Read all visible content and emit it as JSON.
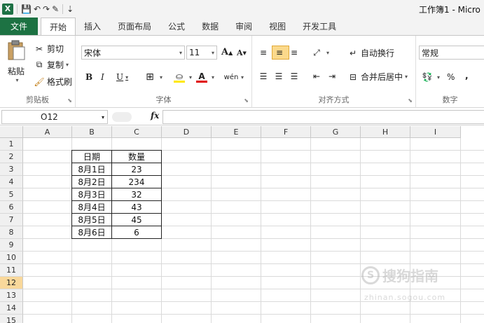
{
  "window": {
    "title": "工作簿1 - Micro"
  },
  "quick_access": {
    "save_glyph": "💾",
    "undo_glyph": "↶",
    "redo_glyph": "↷",
    "brush_glyph": "✎",
    "more_glyph": "⇣"
  },
  "tabs": [
    {
      "label": "文件"
    },
    {
      "label": "开始"
    },
    {
      "label": "插入"
    },
    {
      "label": "页面布局"
    },
    {
      "label": "公式"
    },
    {
      "label": "数据"
    },
    {
      "label": "审阅"
    },
    {
      "label": "视图"
    },
    {
      "label": "开发工具"
    }
  ],
  "clipboard": {
    "paste": "粘贴",
    "cut": "剪切",
    "copy": "复制",
    "format_painter": "格式刷",
    "group_label": "剪贴板"
  },
  "font": {
    "name": "宋体",
    "size": "11",
    "grow": "A",
    "shrink": "A",
    "bold": "B",
    "italic": "I",
    "underline": "U",
    "phonetic": "wén",
    "group_label": "字体"
  },
  "alignment": {
    "wrap_text": "自动换行",
    "merge_center": "合并后居中",
    "group_label": "对齐方式"
  },
  "number": {
    "format": "常规",
    "percent": "%",
    "comma": ",",
    "group_label": "数字"
  },
  "formula_bar": {
    "name_box": "O12",
    "fx": "fx"
  },
  "columns": [
    "A",
    "B",
    "C",
    "D",
    "E",
    "F",
    "G",
    "H",
    "I"
  ],
  "rows": [
    "1",
    "2",
    "3",
    "4",
    "5",
    "6",
    "7",
    "8",
    "9",
    "10",
    "11",
    "12",
    "13",
    "14",
    "15"
  ],
  "selected_row": "12",
  "table": {
    "headers": [
      "日期",
      "数量"
    ],
    "rows": [
      [
        "8月1日",
        "23"
      ],
      [
        "8月2日",
        "234"
      ],
      [
        "8月3日",
        "32"
      ],
      [
        "8月4日",
        "43"
      ],
      [
        "8月5日",
        "45"
      ],
      [
        "8月6日",
        "6"
      ]
    ]
  },
  "watermark": {
    "main": "搜狗指南",
    "sub": "zhinan.sogou.com"
  },
  "colors": {
    "file_tab": "#1d7243",
    "row_selected": "#f9d89b"
  }
}
